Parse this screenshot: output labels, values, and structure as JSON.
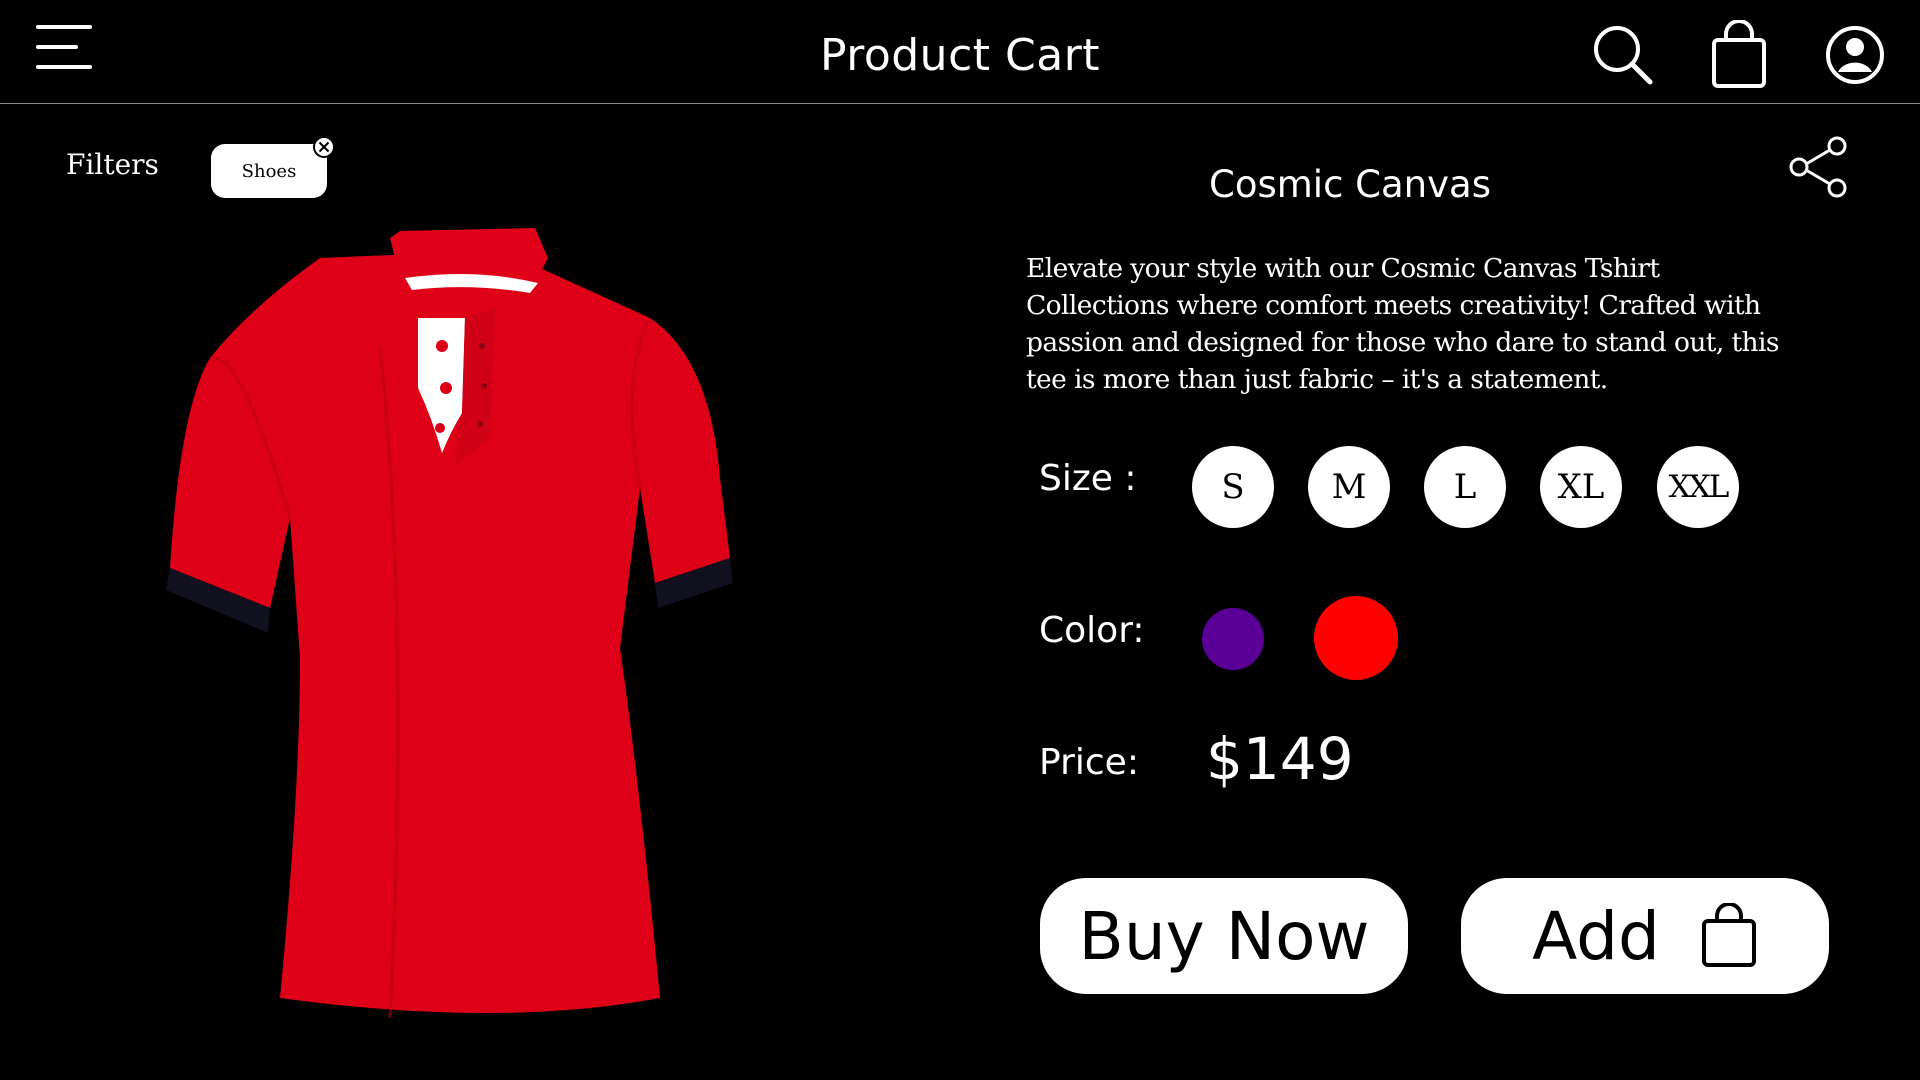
{
  "header": {
    "title": "Product Cart",
    "icons": [
      "menu-icon",
      "search-icon",
      "shopping-bag-icon",
      "user-profile-icon"
    ]
  },
  "filters": {
    "label": "Filters",
    "chips": [
      {
        "label": "Shoes",
        "icon": "close-icon"
      }
    ]
  },
  "product": {
    "title": "Cosmic Canvas",
    "description": "Elevate your style with our Cosmic Canvas Tshirt Collections where comfort meets creativity! Crafted with passion and designed for those who dare to stand out, this tee is more than just fabric – it's a statement.",
    "image_icon": "red-polo-tshirt-image",
    "share_icon": "share-icon"
  },
  "size": {
    "label": "Size :",
    "options": [
      "S",
      "M",
      "L",
      "XL",
      "XXL"
    ]
  },
  "color": {
    "label": "Color:",
    "options": [
      "#5a0096",
      "#ff0000"
    ]
  },
  "price": {
    "label": "Price:",
    "value": "$149"
  },
  "actions": {
    "buy_label": "Buy Now",
    "add_label": "Add",
    "add_icon": "shopping-bag-icon"
  },
  "colors": {
    "background": "#000000",
    "foreground": "#ffffff",
    "shirt": "#dd0016"
  }
}
